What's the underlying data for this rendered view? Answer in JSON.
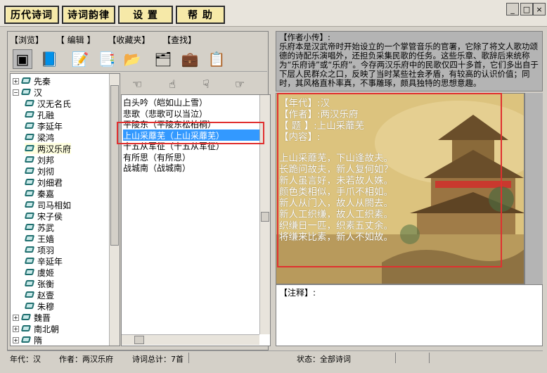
{
  "menu": {
    "items": [
      "历代诗词",
      "诗词韵律",
      "设 置",
      "帮 助"
    ]
  },
  "tabs": [
    "【浏览】",
    "【 编辑 】",
    "【收藏夹】",
    "【查找】"
  ],
  "tree": {
    "roots": [
      {
        "label": "先秦",
        "expanded": false
      },
      {
        "label": "汉",
        "expanded": true
      },
      {
        "label": "魏晋",
        "expanded": false
      },
      {
        "label": "南北朝",
        "expanded": false
      },
      {
        "label": "隋",
        "expanded": false
      }
    ],
    "han_children": [
      "汉无名氏",
      "孔融",
      "李延年",
      "梁鸿",
      "两汉乐府",
      "刘邦",
      "刘彻",
      "刘细君",
      "秦嘉",
      "司马相如",
      "宋子侯",
      "苏武",
      "王嫱",
      "项羽",
      "辛延年",
      "虞姬",
      "张衡",
      "赵壹",
      "朱穆"
    ],
    "selected": "两汉乐府"
  },
  "poems": {
    "items": [
      "白头吟（皑如山上雪）",
      "悲歌（悲歌可以当泣）",
      "平陵东（平陵东松柏桐）",
      "上山采蘼芜（上山采蘼芜）",
      "十五从军征（十五从军征）",
      "有所思（有所思）",
      "战城南（战城南）"
    ],
    "selected_index": 3
  },
  "author_intro": {
    "heading": "【作者小传】:",
    "text": "乐府本是汉武帝时开始设立的一个掌管音乐的官署，它除了将文人歌功颂德的诗配乐演唱外，还担负采集民歌的任务。这些乐章、歌辞后来统称为“乐府诗”或“乐府”。今存两汉乐府中的民歌仅四十多首，它们多出自于下层人民群众之口，反映了当时某些社会矛盾，有较高的认识价值；同时，其风格直朴率真，不事雕琢，颇具独特的思想意趣。"
  },
  "poem_view": {
    "era_label": "【年代】:",
    "era": "汉",
    "author_label": "【作者】:",
    "author": "两汉乐府",
    "title_label": "【 题 】:",
    "title": "上山采蘼芜",
    "content_label": "【内容】:",
    "lines": [
      "上山采蘼芜，下山逢故夫。",
      "长跪问故夫，新人复何如？",
      "新人虽言好，未若故人姝。",
      "颜色类相似，手爪不相如。",
      "新人从门入，故人从閤去。",
      "新人工织缣，故人工织素。",
      "织缣日一匹，织素五丈余。",
      "将缣来比素，新人不如故。"
    ]
  },
  "notes": {
    "heading": "【注释】:"
  },
  "status": {
    "era": "年代：汉",
    "author": "作者：两汉乐府",
    "total": "诗词总计：7首",
    "state": "状态：全部诗词"
  },
  "colors": {
    "selection": "#3399ff",
    "highlight_box": "#e03030",
    "menu_button": "#f6e9a8"
  }
}
